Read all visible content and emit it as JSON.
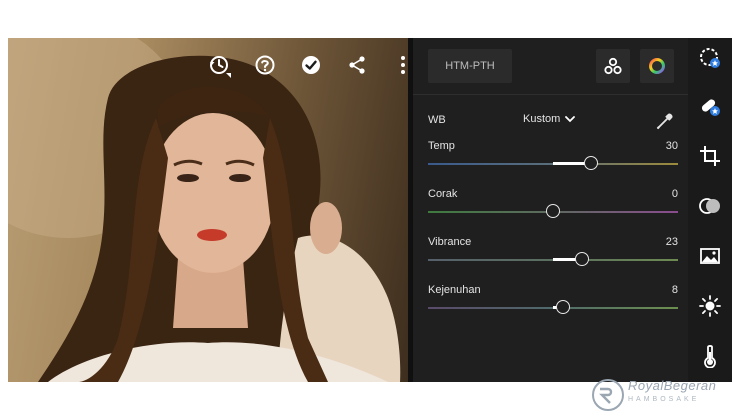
{
  "toolbar": {
    "icons": [
      "history-icon",
      "help-icon",
      "checkmark-icon",
      "share-icon",
      "more-icon"
    ]
  },
  "panel": {
    "preset_label": "HTM-PTH",
    "wb": {
      "label": "WB",
      "value": "Kustom"
    },
    "sliders": [
      {
        "label": "Temp",
        "value": "30",
        "fraction": 0.3
      },
      {
        "label": "Corak",
        "value": "0",
        "fraction": 0.0
      },
      {
        "label": "Vibrance",
        "value": "23",
        "fraction": 0.23
      },
      {
        "label": "Kejenuhan",
        "value": "8",
        "fraction": 0.08
      }
    ]
  },
  "rail": {
    "icons": [
      "auto-icon",
      "healing-icon",
      "crop-icon",
      "masking-icon",
      "presets-icon",
      "light-icon",
      "color-temperature-icon"
    ]
  },
  "watermark": {
    "text": "RoyalBegeran",
    "sub": "HAMBOSAKE"
  },
  "colors": {
    "accent": "#ffffff",
    "panel_bg": "#1f1f1f",
    "rail_bg": "#1a1a1a"
  }
}
